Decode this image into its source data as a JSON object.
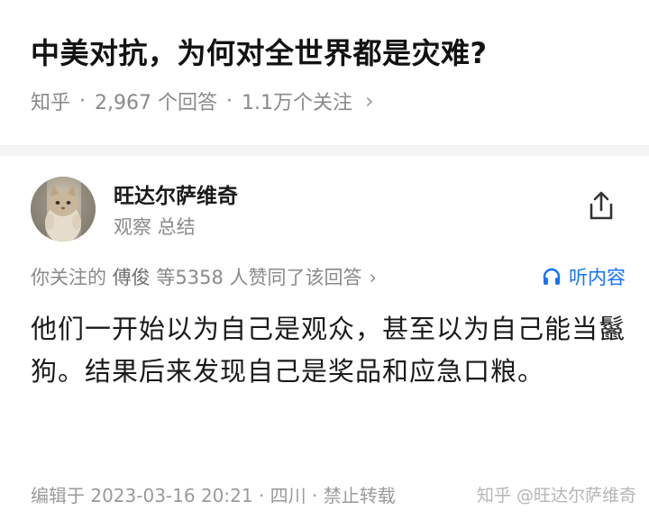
{
  "question": {
    "title": "中美对抗，为何对全世界都是灾难?",
    "source": "知乎",
    "answers": "2,967 个回答",
    "followers": "1.1万个关注",
    "separator": "·",
    "chevron": "›"
  },
  "author": {
    "name": "旺达尔萨维奇",
    "tagline": "观察 总结",
    "avatar_icon": "cat-avatar",
    "share_icon": "share-icon"
  },
  "upvotes": {
    "prefix": "你关注的",
    "friend": "傅俊",
    "suffix": "等5358 人赞同了该回答",
    "chevron": "›",
    "listen_label": "听内容",
    "listen_icon": "headphones-icon",
    "accent": "#1772f6"
  },
  "answer": {
    "text": "他们一开始以为自己是观众，甚至以为自己能当鬣狗。结果后来发现自己是奖品和应急口粮。"
  },
  "footer": {
    "edit_info": "编辑于 2023-03-16 20:21 · 四川 · 禁止转载",
    "watermark": "知乎 @旺达尔萨维奇"
  }
}
